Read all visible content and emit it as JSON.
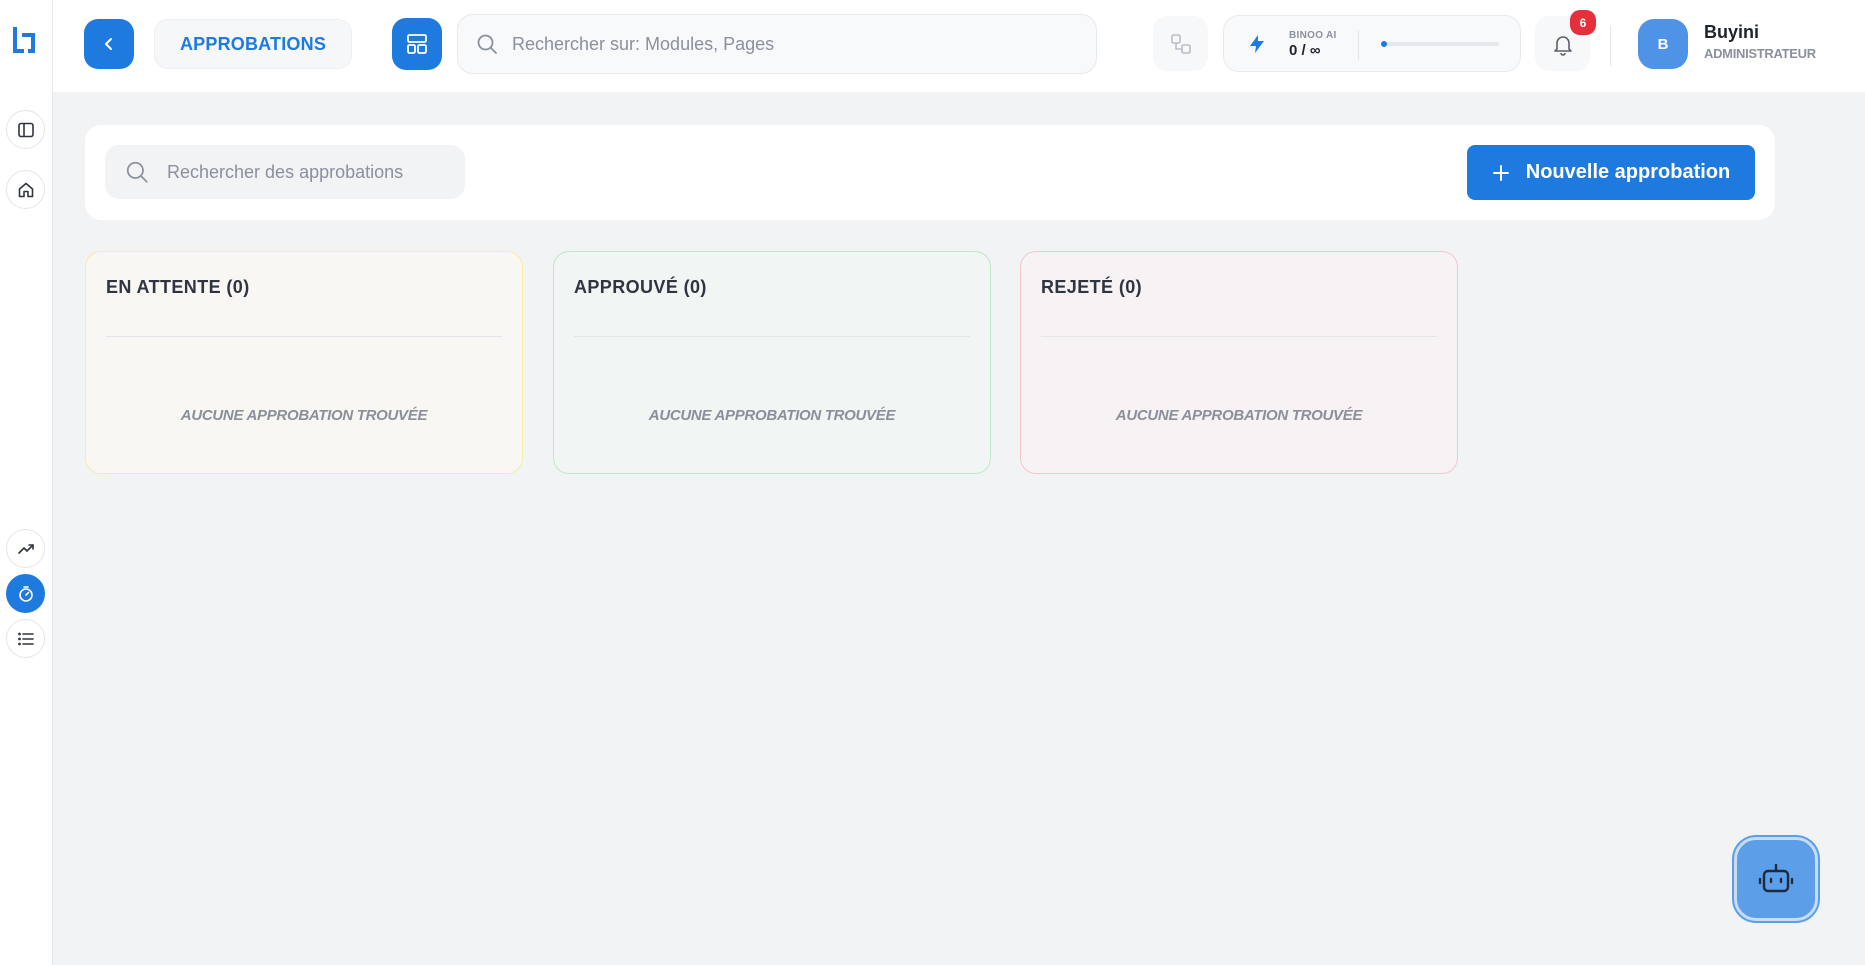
{
  "sidebar": {
    "logo": "logo-icon",
    "top_items": [
      "panel-toggle-icon",
      "home-icon"
    ],
    "bottom_items": [
      "trending-up-icon",
      "timer-icon",
      "list-icon"
    ],
    "active_item": "timer-icon"
  },
  "header": {
    "breadcrumb": "APPROBATIONS",
    "search_placeholder": "Rechercher sur: Modules, Pages",
    "ai": {
      "label": "BINOO AI",
      "count": "0 / ∞",
      "usage_fraction": 0.05
    },
    "notifications": {
      "count": "6"
    },
    "user": {
      "initial": "B",
      "name": "Buyini",
      "role": "ADMINISTRATEUR"
    }
  },
  "toolbar": {
    "search_placeholder": "Rechercher des approbations",
    "new_button_label": "Nouvelle approbation"
  },
  "columns": [
    {
      "title": "EN ATTENTE (0)",
      "empty_text": "AUCUNE APPROBATION TROUVÉE",
      "bg": "#f8f7f3",
      "border": "#f7eda0"
    },
    {
      "title": "APPROUVÉ (0)",
      "empty_text": "AUCUNE APPROBATION TROUVÉE",
      "bg": "#f1f5f4",
      "border": "#bfe8c8"
    },
    {
      "title": "REJETÉ (0)",
      "empty_text": "AUCUNE APPROBATION TROUVÉE",
      "bg": "#f7f2f4",
      "border": "#f4c7cc"
    }
  ],
  "colors": {
    "accent": "#1f7ae0",
    "badge": "#e5303b",
    "background": "#f2f3f5"
  }
}
